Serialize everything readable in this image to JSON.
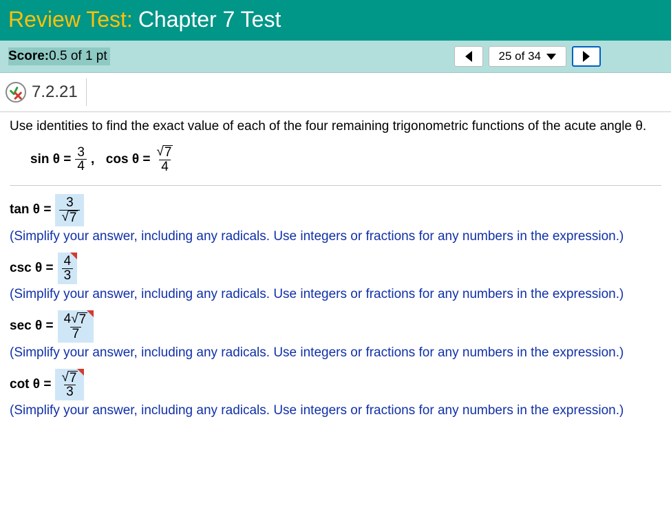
{
  "header": {
    "prefix": "Review Test:",
    "title": "Chapter 7 Test"
  },
  "score": {
    "label": "Score:",
    "value": " 0.5 of 1 pt"
  },
  "nav": {
    "position": "25 of 34"
  },
  "question": {
    "id": "7.2.21",
    "prompt": "Use identities to find the exact value of each of the four remaining trigonometric functions of the acute angle θ.",
    "given": {
      "sin_num": "3",
      "sin_den": "4",
      "cos_num_sqrt": "7",
      "cos_den": "4"
    },
    "answers": {
      "tan": {
        "num": "3",
        "den_sqrt": "7"
      },
      "csc": {
        "num": "4",
        "den": "3"
      },
      "sec": {
        "num_coeff": "4",
        "num_sqrt": "7",
        "den": "7"
      },
      "cot": {
        "num_sqrt": "7",
        "den": "3"
      }
    },
    "hint": "(Simplify your answer, including any radicals. Use integers or fractions for any numbers in the expression.)"
  },
  "labels": {
    "sin": "sin θ =",
    "cos": "cos θ =",
    "tan": "tan θ =",
    "csc": "csc θ =",
    "sec": "sec θ =",
    "cot": "cot θ ="
  }
}
